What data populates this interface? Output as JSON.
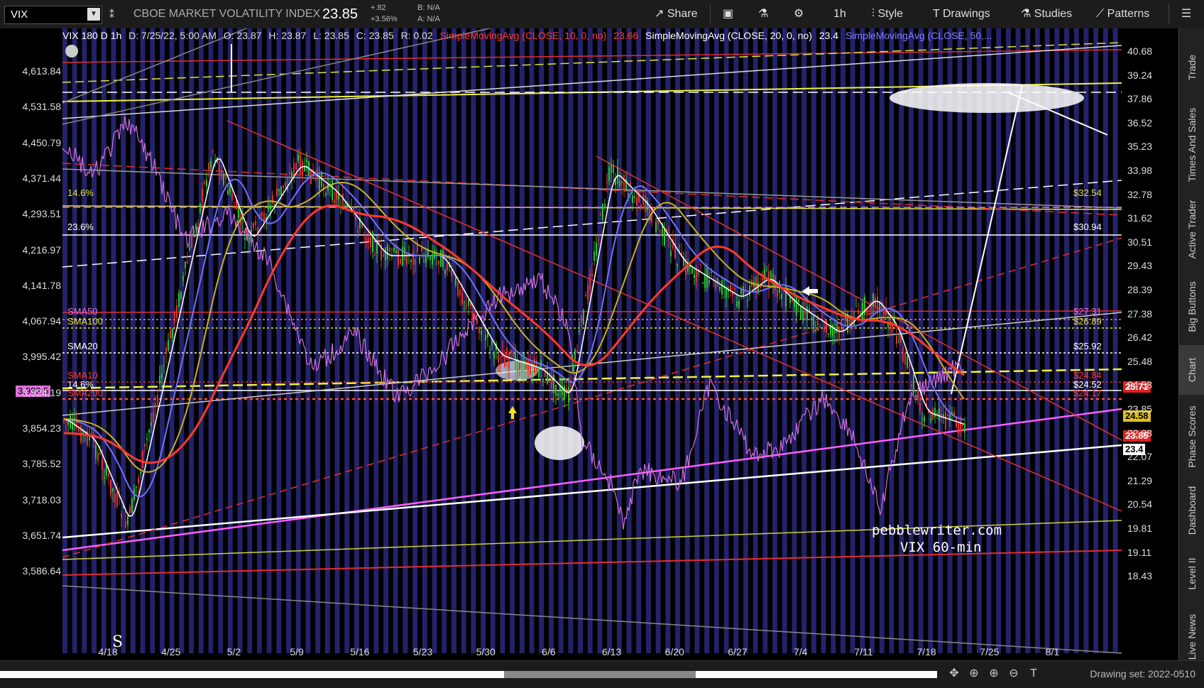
{
  "toolbar": {
    "symbol": "VIX",
    "symbol_desc": "CBOE MARKET VOLATILITY INDEX",
    "last": "23.85",
    "change": "+.82",
    "change_pct": "+3.56%",
    "bid": "B: N/A",
    "ask": "A: N/A",
    "share": "Share",
    "timeframe": "1h",
    "style": "Style",
    "drawings": "Drawings",
    "studies": "Studies",
    "patterns": "Patterns"
  },
  "infobar": {
    "label": "VIX 180 D 1h",
    "date": "D: 7/25/22, 5:00 AM",
    "open": "O: 23.87",
    "high": "H: 23.87",
    "low": "L: 23.85",
    "close": "C: 23.85",
    "range": "R: 0.02",
    "sma10": "SimpleMovingAvg (CLOSE, 10, 0, no)",
    "sma10_val": "23.66",
    "sma20": "SimpleMovingAvg (CLOSE, 20, 0, no)",
    "sma20_val": "23.4",
    "sma50": "SimpleMovingAvg (CLOSE, 50,..."
  },
  "left_axis": [
    "4,613.84",
    "4,531.58",
    "4,450.79",
    "4,371.44",
    "4,293.51",
    "4,216.97",
    "4,141.78",
    "4,067.94",
    "3,995.42",
    "3,924.19",
    "3,854.23",
    "3,785.52",
    "3,718.03",
    "3,651.74",
    "3,586.64"
  ],
  "left_tag": "3,983.5",
  "right_axis": [
    "40.68",
    "39.24",
    "37.86",
    "36.52",
    "35.23",
    "33.98",
    "32.78",
    "31.62",
    "30.51",
    "29.43",
    "28.39",
    "27.38",
    "26.42",
    "25.48",
    "24.58",
    "23.85",
    "22.88",
    "22.07",
    "21.29",
    "20.54",
    "19.81",
    "19.11",
    "18.43"
  ],
  "right_tags": {
    "p1": "25.71",
    "p2": "24.58",
    "p3": "23.85",
    "p4": "23.4"
  },
  "x_axis": [
    "4/18",
    "4/25",
    "5/2",
    "5/9",
    "5/16",
    "5/23",
    "5/30",
    "6/6",
    "6/13",
    "6/20",
    "6/27",
    "7/4",
    "7/11",
    "7/18",
    "7/25",
    "8/1"
  ],
  "annotations": {
    "fib146_top": "14.6%",
    "fib236": "23.6%",
    "sma50": "SMA50",
    "sma100": "SMA100",
    "sma20": "SMA20",
    "sma10": "SMA10",
    "sma200": "SMA200",
    "fib146_low": "14.6%",
    "v3254": "$32.54",
    "v3094": "$30.94",
    "v2731": "$27.31",
    "v2689": "$26.89",
    "v2592": "$25.92",
    "v2484": "$24.84",
    "v2452": "$24.52",
    "v2417": "$24.17",
    "s_marker": "S"
  },
  "watermark": {
    "line1": "pebblewriter.com",
    "line2": "VIX 60-min"
  },
  "right_panel": [
    "Trade",
    "Times And Sales",
    "Active Trader",
    "Big Buttons",
    "Chart",
    "Phase Scores",
    "Dashboard",
    "Level II",
    "Live News"
  ],
  "bottom": {
    "drawing_set": "Drawing set: 2022-0510"
  },
  "colors": {
    "bg": "#000000",
    "stripe": "#262675",
    "up": "#2ec02e",
    "down": "#e03030",
    "sma10": "#ff3a2a",
    "sma20": "#ffffff",
    "sma50": "#7070ff",
    "sma100": "#c8b020",
    "spx": "#d070e0"
  }
}
